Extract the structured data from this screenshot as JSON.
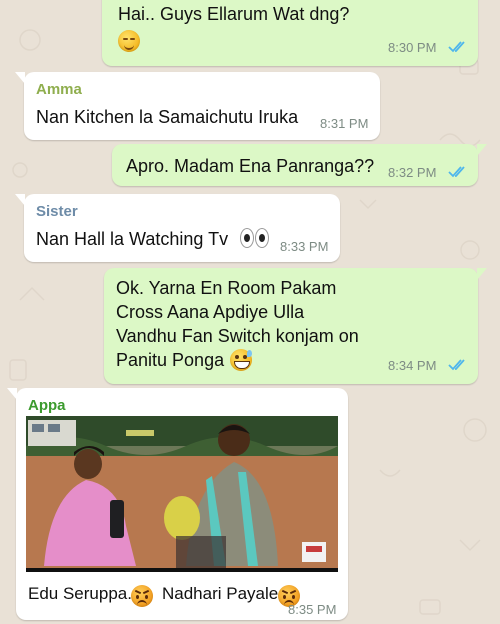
{
  "colors": {
    "chat_background": "#e9e1d6",
    "outgoing_bubble": "#dcf8c6",
    "incoming_bubble": "#ffffff",
    "read_ticks": "#4fb6ec",
    "sender_amma": "#8fae4e",
    "sender_sister": "#6e8ca8",
    "sender_appa": "#3c9b2e"
  },
  "messages": [
    {
      "type": "outgoing",
      "text": "Hai.. Guys Ellarum Wat dng?",
      "emoji": "relieved-face-emoji",
      "time": "8:30 PM",
      "status": "read"
    },
    {
      "type": "incoming",
      "sender": "Amma",
      "text": "Nan Kitchen la Samaichutu Iruka",
      "time": "8:31 PM"
    },
    {
      "type": "outgoing",
      "text": "Apro. Madam Ena Panranga??",
      "time": "8:32 PM",
      "status": "read"
    },
    {
      "type": "incoming",
      "sender": "Sister",
      "text": "Nan Hall la Watching Tv",
      "emoji": "eyes-emoji",
      "time": "8:33 PM"
    },
    {
      "type": "outgoing",
      "lines": [
        "Ok. Yarna En Room Pakam",
        "Cross Aana Apdiye Ulla",
        "Vandhu Fan Switch konjam on",
        "Panitu Ponga"
      ],
      "emoji": "grinning-sweat-emoji",
      "time": "8:34 PM",
      "status": "read"
    },
    {
      "type": "incoming",
      "sender": "Appa",
      "media": "meme-photo",
      "caption_parts": [
        "Edu Seruppa.",
        "Nadhari Payale"
      ],
      "emoji": "angry-face-emoji",
      "time": "8:35 PM"
    }
  ]
}
